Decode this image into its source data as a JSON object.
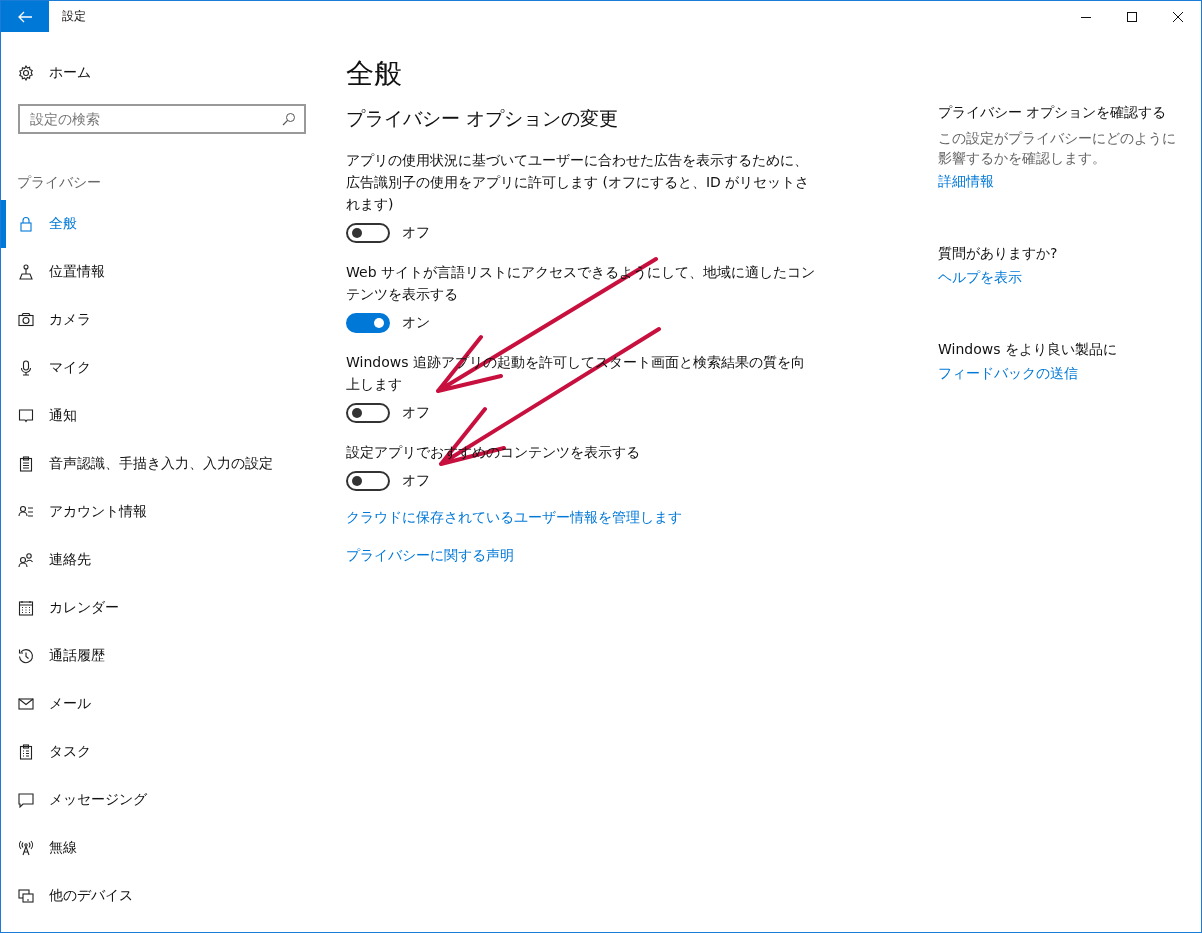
{
  "window": {
    "title": "設定"
  },
  "sidebar": {
    "home": "ホーム",
    "search": {
      "placeholder": "設定の検索"
    },
    "section": "プライバシー",
    "items": [
      {
        "label": "全般",
        "selected": true
      },
      {
        "label": "位置情報",
        "selected": false
      },
      {
        "label": "カメラ",
        "selected": false
      },
      {
        "label": "マイク",
        "selected": false
      },
      {
        "label": "通知",
        "selected": false
      },
      {
        "label": "音声認識、手描き入力、入力の設定",
        "selected": false
      },
      {
        "label": "アカウント情報",
        "selected": false
      },
      {
        "label": "連絡先",
        "selected": false
      },
      {
        "label": "カレンダー",
        "selected": false
      },
      {
        "label": "通話履歴",
        "selected": false
      },
      {
        "label": "メール",
        "selected": false
      },
      {
        "label": "タスク",
        "selected": false
      },
      {
        "label": "メッセージング",
        "selected": false
      },
      {
        "label": "無線",
        "selected": false
      },
      {
        "label": "他のデバイス",
        "selected": false
      }
    ]
  },
  "content": {
    "title": "全般",
    "subtitle": "プライバシー オプションの変更",
    "settings": [
      {
        "description": "アプリの使用状況に基づいてユーザーに合わせた広告を表示するために、広告識別子の使用をアプリに許可します (オフにすると、ID がリセットされます)",
        "on": false,
        "state_label": "オフ"
      },
      {
        "description": "Web サイトが言語リストにアクセスできるようにして、地域に適したコンテンツを表示する",
        "on": true,
        "state_label": "オン"
      },
      {
        "description": "Windows 追跡アプリの起動を許可してスタート画面と検索結果の質を向上します",
        "on": false,
        "state_label": "オフ"
      },
      {
        "description": "設定アプリでおすすめのコンテンツを表示する",
        "on": false,
        "state_label": "オフ"
      }
    ],
    "links": [
      "クラウドに保存されているユーザー情報を管理します",
      "プライバシーに関する声明"
    ]
  },
  "aside": [
    {
      "heading": "プライバシー オプションを確認する",
      "body": "この設定がプライバシーにどのように影響するかを確認します。",
      "link": "詳細情報"
    },
    {
      "heading": "質問がありますか?",
      "link": "ヘルプを表示"
    },
    {
      "heading": "Windows をより良い製品に",
      "link": "フィードバックの送信"
    }
  ]
}
